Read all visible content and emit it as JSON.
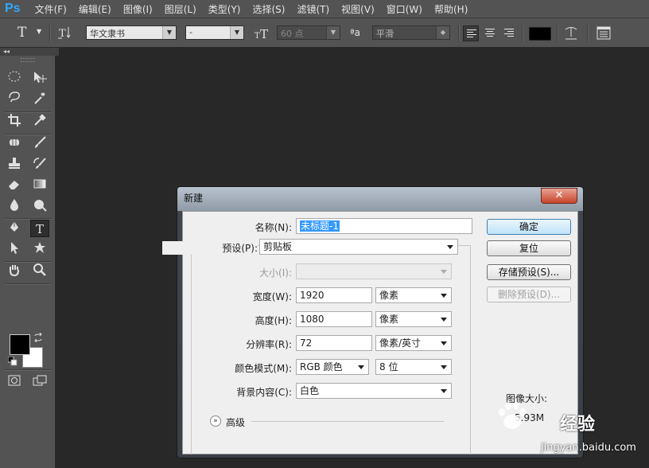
{
  "app": {
    "logo": "Ps"
  },
  "menu": [
    "文件(F)",
    "编辑(E)",
    "图像(I)",
    "图层(L)",
    "类型(Y)",
    "选择(S)",
    "滤镜(T)",
    "视图(V)",
    "窗口(W)",
    "帮助(H)"
  ],
  "options": {
    "tool_glyph": "T",
    "font_family": "华文隶书",
    "font_style": "-",
    "font_size": "60 点",
    "aa_label": "ªa",
    "antialias": "平滑",
    "text_color": "#000000"
  },
  "dialog": {
    "title": "新建",
    "close_glyph": "✕",
    "name_label": "名称(N):",
    "name_value": "未标题-1",
    "preset_label": "预设(P):",
    "preset_value": "剪贴板",
    "size_label": "大小(I):",
    "size_value": "",
    "width_label": "宽度(W):",
    "width_value": "1920",
    "width_unit": "像素",
    "height_label": "高度(H):",
    "height_value": "1080",
    "height_unit": "像素",
    "resolution_label": "分辨率(R):",
    "resolution_value": "72",
    "resolution_unit": "像素/英寸",
    "color_mode_label": "颜色模式(M):",
    "color_mode_value": "RGB 颜色",
    "bit_depth": "8 位",
    "background_label": "背景内容(C):",
    "background_value": "白色",
    "advanced_label": "高级",
    "buttons": {
      "ok": "确定",
      "reset": "复位",
      "save_preset": "存储预设(S)...",
      "delete_preset": "删除预设(D)..."
    },
    "image_size_label": "图像大小:",
    "image_size_value": "5.93M"
  },
  "watermark": {
    "text": "经验",
    "url": "jingyan.baidu.com"
  },
  "colors": {
    "foreground": "#000000",
    "background": "#ffffff",
    "selection": "#3399ff"
  }
}
